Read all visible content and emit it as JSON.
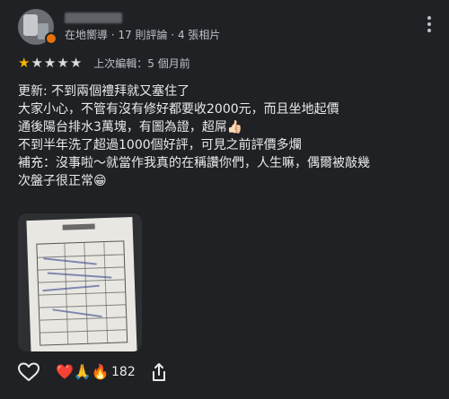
{
  "reviewer": {
    "meta": "在地嚮導 · 17 則評論 · 4 張相片"
  },
  "rating": {
    "stars_filled": 1,
    "stars_total": 5,
    "edited": "上次編輯：5 個月前"
  },
  "review": {
    "text": "更新: 不到兩個禮拜就又塞住了\n大家小心，不管有沒有修好都要收2000元，而且坐地起價\n通後陽台排水3萬塊，有圖為證，超屌👍🏻\n不到半年洗了超過1000個好評，可見之前評價多爛\n補充：沒事啦～就當作我真的在稱讚你們，人生嘛，偶爾被敲幾\n次盤子很正常😁"
  },
  "photo": {
    "icon": "receipt-photo"
  },
  "actions": {
    "reaction_emojis": "❤️🙏🔥",
    "reaction_count": "182"
  },
  "icons": [
    "avatar",
    "local-guide-badge",
    "more-vert-icon",
    "star-icon",
    "heart-outline-icon",
    "share-icon"
  ],
  "colors": {
    "background": "#202124",
    "star": "#f6b400",
    "badge": "#e8710a"
  }
}
